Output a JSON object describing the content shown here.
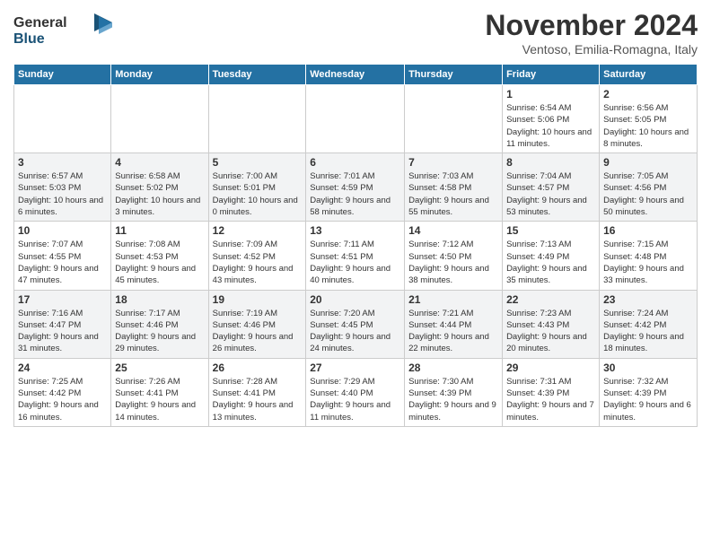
{
  "header": {
    "logo_line1": "General",
    "logo_line2": "Blue",
    "title": "November 2024",
    "subtitle": "Ventoso, Emilia-Romagna, Italy"
  },
  "columns": [
    "Sunday",
    "Monday",
    "Tuesday",
    "Wednesday",
    "Thursday",
    "Friday",
    "Saturday"
  ],
  "weeks": [
    {
      "cells": [
        {
          "day": "",
          "info": ""
        },
        {
          "day": "",
          "info": ""
        },
        {
          "day": "",
          "info": ""
        },
        {
          "day": "",
          "info": ""
        },
        {
          "day": "",
          "info": ""
        },
        {
          "day": "1",
          "info": "Sunrise: 6:54 AM\nSunset: 5:06 PM\nDaylight: 10 hours and 11 minutes."
        },
        {
          "day": "2",
          "info": "Sunrise: 6:56 AM\nSunset: 5:05 PM\nDaylight: 10 hours and 8 minutes."
        }
      ]
    },
    {
      "cells": [
        {
          "day": "3",
          "info": "Sunrise: 6:57 AM\nSunset: 5:03 PM\nDaylight: 10 hours and 6 minutes."
        },
        {
          "day": "4",
          "info": "Sunrise: 6:58 AM\nSunset: 5:02 PM\nDaylight: 10 hours and 3 minutes."
        },
        {
          "day": "5",
          "info": "Sunrise: 7:00 AM\nSunset: 5:01 PM\nDaylight: 10 hours and 0 minutes."
        },
        {
          "day": "6",
          "info": "Sunrise: 7:01 AM\nSunset: 4:59 PM\nDaylight: 9 hours and 58 minutes."
        },
        {
          "day": "7",
          "info": "Sunrise: 7:03 AM\nSunset: 4:58 PM\nDaylight: 9 hours and 55 minutes."
        },
        {
          "day": "8",
          "info": "Sunrise: 7:04 AM\nSunset: 4:57 PM\nDaylight: 9 hours and 53 minutes."
        },
        {
          "day": "9",
          "info": "Sunrise: 7:05 AM\nSunset: 4:56 PM\nDaylight: 9 hours and 50 minutes."
        }
      ]
    },
    {
      "cells": [
        {
          "day": "10",
          "info": "Sunrise: 7:07 AM\nSunset: 4:55 PM\nDaylight: 9 hours and 47 minutes."
        },
        {
          "day": "11",
          "info": "Sunrise: 7:08 AM\nSunset: 4:53 PM\nDaylight: 9 hours and 45 minutes."
        },
        {
          "day": "12",
          "info": "Sunrise: 7:09 AM\nSunset: 4:52 PM\nDaylight: 9 hours and 43 minutes."
        },
        {
          "day": "13",
          "info": "Sunrise: 7:11 AM\nSunset: 4:51 PM\nDaylight: 9 hours and 40 minutes."
        },
        {
          "day": "14",
          "info": "Sunrise: 7:12 AM\nSunset: 4:50 PM\nDaylight: 9 hours and 38 minutes."
        },
        {
          "day": "15",
          "info": "Sunrise: 7:13 AM\nSunset: 4:49 PM\nDaylight: 9 hours and 35 minutes."
        },
        {
          "day": "16",
          "info": "Sunrise: 7:15 AM\nSunset: 4:48 PM\nDaylight: 9 hours and 33 minutes."
        }
      ]
    },
    {
      "cells": [
        {
          "day": "17",
          "info": "Sunrise: 7:16 AM\nSunset: 4:47 PM\nDaylight: 9 hours and 31 minutes."
        },
        {
          "day": "18",
          "info": "Sunrise: 7:17 AM\nSunset: 4:46 PM\nDaylight: 9 hours and 29 minutes."
        },
        {
          "day": "19",
          "info": "Sunrise: 7:19 AM\nSunset: 4:46 PM\nDaylight: 9 hours and 26 minutes."
        },
        {
          "day": "20",
          "info": "Sunrise: 7:20 AM\nSunset: 4:45 PM\nDaylight: 9 hours and 24 minutes."
        },
        {
          "day": "21",
          "info": "Sunrise: 7:21 AM\nSunset: 4:44 PM\nDaylight: 9 hours and 22 minutes."
        },
        {
          "day": "22",
          "info": "Sunrise: 7:23 AM\nSunset: 4:43 PM\nDaylight: 9 hours and 20 minutes."
        },
        {
          "day": "23",
          "info": "Sunrise: 7:24 AM\nSunset: 4:42 PM\nDaylight: 9 hours and 18 minutes."
        }
      ]
    },
    {
      "cells": [
        {
          "day": "24",
          "info": "Sunrise: 7:25 AM\nSunset: 4:42 PM\nDaylight: 9 hours and 16 minutes."
        },
        {
          "day": "25",
          "info": "Sunrise: 7:26 AM\nSunset: 4:41 PM\nDaylight: 9 hours and 14 minutes."
        },
        {
          "day": "26",
          "info": "Sunrise: 7:28 AM\nSunset: 4:41 PM\nDaylight: 9 hours and 13 minutes."
        },
        {
          "day": "27",
          "info": "Sunrise: 7:29 AM\nSunset: 4:40 PM\nDaylight: 9 hours and 11 minutes."
        },
        {
          "day": "28",
          "info": "Sunrise: 7:30 AM\nSunset: 4:39 PM\nDaylight: 9 hours and 9 minutes."
        },
        {
          "day": "29",
          "info": "Sunrise: 7:31 AM\nSunset: 4:39 PM\nDaylight: 9 hours and 7 minutes."
        },
        {
          "day": "30",
          "info": "Sunrise: 7:32 AM\nSunset: 4:39 PM\nDaylight: 9 hours and 6 minutes."
        }
      ]
    }
  ]
}
